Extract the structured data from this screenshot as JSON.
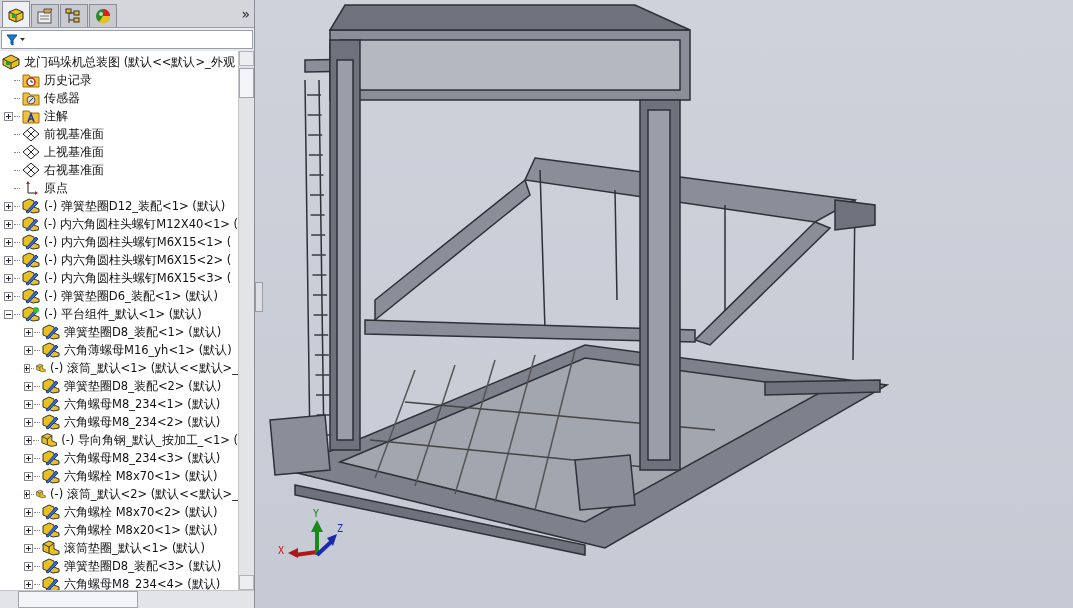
{
  "panel_tabs": [
    {
      "kind": "feature-manager",
      "selected": true
    },
    {
      "kind": "property-manager",
      "selected": false
    },
    {
      "kind": "configuration-manager",
      "selected": false
    },
    {
      "kind": "appearance",
      "selected": false
    }
  ],
  "expand_tabs": "»",
  "feature_tree": {
    "kind": "assembly",
    "label": "龙门码垛机总装图  (默认<<默认>_外观",
    "children": [
      {
        "kind": "history",
        "label": "历史记录"
      },
      {
        "kind": "sensors",
        "label": "传感器"
      },
      {
        "kind": "annotations",
        "label": "注解",
        "expanded": false
      },
      {
        "kind": "plane",
        "label": "前视基准面"
      },
      {
        "kind": "plane",
        "label": "上视基准面"
      },
      {
        "kind": "plane",
        "label": "右视基准面"
      },
      {
        "kind": "origin",
        "label": "原点"
      },
      {
        "kind": "sub-part",
        "label": "(-) 弹簧垫圈D12_装配<1> (默认)",
        "expanded": false
      },
      {
        "kind": "sub-part",
        "label": "(-) 内六角圆柱头螺钉M12X40<1> (",
        "expanded": false
      },
      {
        "kind": "sub-part",
        "label": "(-) 内六角圆柱头螺钉M6X15<1> (",
        "expanded": false
      },
      {
        "kind": "sub-part",
        "label": "(-) 内六角圆柱头螺钉M6X15<2> (",
        "expanded": false
      },
      {
        "kind": "sub-part",
        "label": "(-) 内六角圆柱头螺钉M6X15<3> (",
        "expanded": false
      },
      {
        "kind": "sub-part",
        "label": "(-) 弹簧垫圈D6_装配<1> (默认)",
        "expanded": false
      },
      {
        "kind": "sub-assembly",
        "label": "(-) 平台组件_默认<1> (默认)",
        "expanded": true,
        "children": [
          {
            "kind": "sub-part",
            "label": "弹簧垫圈D8_装配<1> (默认)",
            "expanded": false
          },
          {
            "kind": "sub-part",
            "label": "六角薄螺母M16_yh<1> (默认)",
            "expanded": false
          },
          {
            "kind": "part",
            "label": "(-) 滚筒_默认<1> (默认<<默认>_",
            "expanded": false
          },
          {
            "kind": "sub-part",
            "label": "弹簧垫圈D8_装配<2> (默认)",
            "expanded": false
          },
          {
            "kind": "sub-part",
            "label": "六角螺母M8_234<1> (默认)",
            "expanded": false
          },
          {
            "kind": "sub-part",
            "label": "六角螺母M8_234<2> (默认)",
            "expanded": false
          },
          {
            "kind": "part",
            "label": "(-) 导向角钢_默认_按加工_<1> (",
            "expanded": false
          },
          {
            "kind": "sub-part",
            "label": "六角螺母M8_234<3> (默认)",
            "expanded": false
          },
          {
            "kind": "sub-part",
            "label": "六角螺栓 M8x70<1> (默认)",
            "expanded": false
          },
          {
            "kind": "part",
            "label": "(-) 滚筒_默认<2> (默认<<默认>_",
            "expanded": false
          },
          {
            "kind": "sub-part",
            "label": "六角螺栓 M8x70<2> (默认)",
            "expanded": false
          },
          {
            "kind": "sub-part",
            "label": "六角螺栓 M8x20<1> (默认)",
            "expanded": false
          },
          {
            "kind": "part",
            "label": "滚筒垫圈_默认<1> (默认)",
            "expanded": false
          },
          {
            "kind": "sub-part",
            "label": "弹簧垫圈D8_装配<3> (默认)",
            "expanded": false
          },
          {
            "kind": "sub-part",
            "label": "六角螺母M8_234<4> (默认)",
            "expanded": false
          }
        ]
      }
    ]
  },
  "triad": {
    "x": "X",
    "y": "Y",
    "z": "Z"
  }
}
